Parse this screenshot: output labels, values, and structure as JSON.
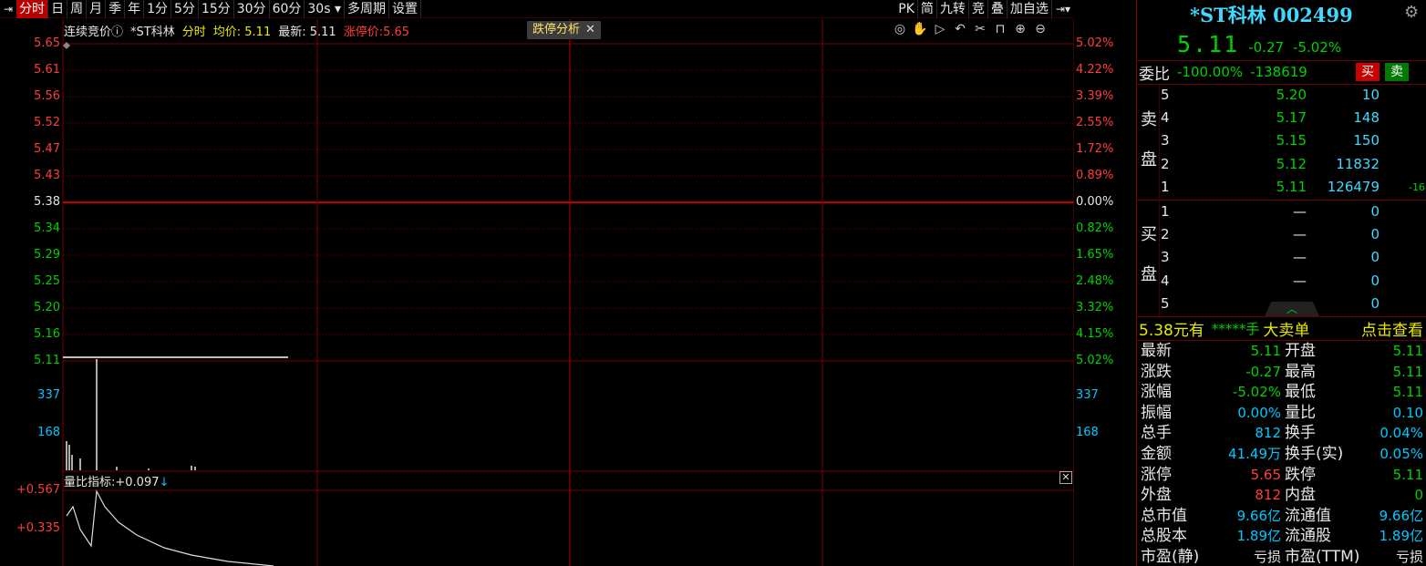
{
  "toolbar": {
    "items": [
      "分时",
      "日",
      "周",
      "月",
      "季",
      "年",
      "1分",
      "5分",
      "15分",
      "30分",
      "60分",
      "30s ▾",
      "多周期",
      "设置"
    ],
    "right_items": [
      "PK",
      "简",
      "九转",
      "竞",
      "叠",
      "加自选"
    ]
  },
  "chart": {
    "info": {
      "mode": "连续竞价ⓘ",
      "name": "*ST科林",
      "view": "分时",
      "avg_label": "均价:",
      "avg_value": "5.11",
      "last_label": "最新:",
      "last_value": "5.11",
      "limit_label": "涨停价:",
      "limit_value": "5.65"
    },
    "pill_label": "跌停分析",
    "pill_close": "✕",
    "icons": [
      "eye-icon",
      "hand-icon",
      "play-icon",
      "undo-icon",
      "scissors-icon",
      "lock-icon",
      "zoom-in-icon",
      "zoom-out-icon"
    ],
    "left_price_axis": [
      {
        "v": "5.65",
        "c": "red"
      },
      {
        "v": "5.61",
        "c": "red"
      },
      {
        "v": "5.56",
        "c": "red"
      },
      {
        "v": "5.52",
        "c": "red"
      },
      {
        "v": "5.47",
        "c": "red"
      },
      {
        "v": "5.43",
        "c": "red"
      },
      {
        "v": "5.38",
        "c": "white"
      },
      {
        "v": "5.34",
        "c": "green"
      },
      {
        "v": "5.29",
        "c": "green"
      },
      {
        "v": "5.25",
        "c": "green"
      },
      {
        "v": "5.20",
        "c": "green"
      },
      {
        "v": "5.16",
        "c": "green"
      },
      {
        "v": "5.11",
        "c": "green"
      }
    ],
    "right_pct_axis": [
      {
        "v": "5.02%",
        "c": "red"
      },
      {
        "v": "4.22%",
        "c": "red"
      },
      {
        "v": "3.39%",
        "c": "red"
      },
      {
        "v": "2.55%",
        "c": "red"
      },
      {
        "v": "1.72%",
        "c": "red"
      },
      {
        "v": "0.89%",
        "c": "red"
      },
      {
        "v": "0.00%",
        "c": "white"
      },
      {
        "v": "0.82%",
        "c": "green"
      },
      {
        "v": "1.65%",
        "c": "green"
      },
      {
        "v": "2.48%",
        "c": "green"
      },
      {
        "v": "3.32%",
        "c": "green"
      },
      {
        "v": "4.15%",
        "c": "green"
      },
      {
        "v": "5.02%",
        "c": "green"
      }
    ],
    "volume_axis": [
      "337",
      "168"
    ],
    "volume_ratio": {
      "label": "量比指标:",
      "value": "+0.097",
      "arrow": "↓",
      "axis": [
        "+0.567",
        "+0.335"
      ],
      "close": "✕"
    }
  },
  "quote": {
    "title": "*ST科林 002499",
    "price": "5.11",
    "change": "-0.27",
    "change_pct": "-5.02%",
    "weibi_label": "委比",
    "weibi_pct": "-100.00%",
    "weibi_diff": "-138619",
    "buy_btn": "买",
    "sell_btn": "卖",
    "sell_side_label": [
      "卖",
      "盘"
    ],
    "buy_side_label": [
      "买",
      "盘"
    ],
    "asks": [
      {
        "lv": "5",
        "price": "5.20",
        "vol": "10",
        "chg": ""
      },
      {
        "lv": "4",
        "price": "5.17",
        "vol": "148",
        "chg": ""
      },
      {
        "lv": "3",
        "price": "5.15",
        "vol": "150",
        "chg": ""
      },
      {
        "lv": "2",
        "price": "5.12",
        "vol": "11832",
        "chg": ""
      },
      {
        "lv": "1",
        "price": "5.11",
        "vol": "126479",
        "chg": "-16"
      }
    ],
    "bids": [
      {
        "lv": "1",
        "price": "—",
        "vol": "0"
      },
      {
        "lv": "2",
        "price": "—",
        "vol": "0"
      },
      {
        "lv": "3",
        "price": "—",
        "vol": "0"
      },
      {
        "lv": "4",
        "price": "—",
        "vol": "0"
      },
      {
        "lv": "5",
        "price": "",
        "vol": "0"
      }
    ],
    "bigorder": {
      "price": "5.38",
      "unit": "元有",
      "masked": "*****手",
      "tag": "大卖单",
      "link": "点击查看"
    },
    "stats": [
      {
        "l1": "最新",
        "v1": "5.11",
        "c1": "green",
        "l2": "开盘",
        "v2": "5.11",
        "c2": "green"
      },
      {
        "l1": "涨跌",
        "v1": "-0.27",
        "c1": "green",
        "l2": "最高",
        "v2": "5.11",
        "c2": "green"
      },
      {
        "l1": "涨幅",
        "v1": "-5.02%",
        "c1": "green",
        "l2": "最低",
        "v2": "5.11",
        "c2": "green"
      },
      {
        "l1": "振幅",
        "v1": "0.00%",
        "c1": "cyan",
        "l2": "量比",
        "v2": "0.10",
        "c2": "cyan"
      },
      {
        "l1": "总手",
        "v1": "812",
        "c1": "cyan",
        "l2": "换手",
        "v2": "0.04%",
        "c2": "cyan"
      },
      {
        "l1": "金额",
        "v1": "41.49万",
        "c1": "cyan",
        "l2": "换手(实)",
        "v2": "0.05%",
        "c2": "cyan"
      },
      {
        "l1": "涨停",
        "v1": "5.65",
        "c1": "red",
        "l2": "跌停",
        "v2": "5.11",
        "c2": "green"
      },
      {
        "l1": "外盘",
        "v1": "812",
        "c1": "red",
        "l2": "内盘",
        "v2": "0",
        "c2": "green"
      },
      {
        "l1": "总市值",
        "v1": "9.66亿",
        "c1": "cyan",
        "l2": "流通值",
        "v2": "9.66亿",
        "c2": "cyan"
      },
      {
        "l1": "总股本",
        "v1": "1.89亿",
        "c1": "cyan",
        "l2": "流通股",
        "v2": "1.89亿",
        "c2": "cyan"
      },
      {
        "l1": "市盈(静)",
        "v1": "亏损",
        "c1": "white",
        "l2": "市盈(TTM)",
        "v2": "亏损",
        "c2": "white"
      }
    ]
  },
  "colors": {
    "up": "#ff3c3c",
    "down": "#00d200",
    "neutral": "#e6e6e6",
    "info": "#3fd8ff",
    "grid": "#7a0000"
  }
}
